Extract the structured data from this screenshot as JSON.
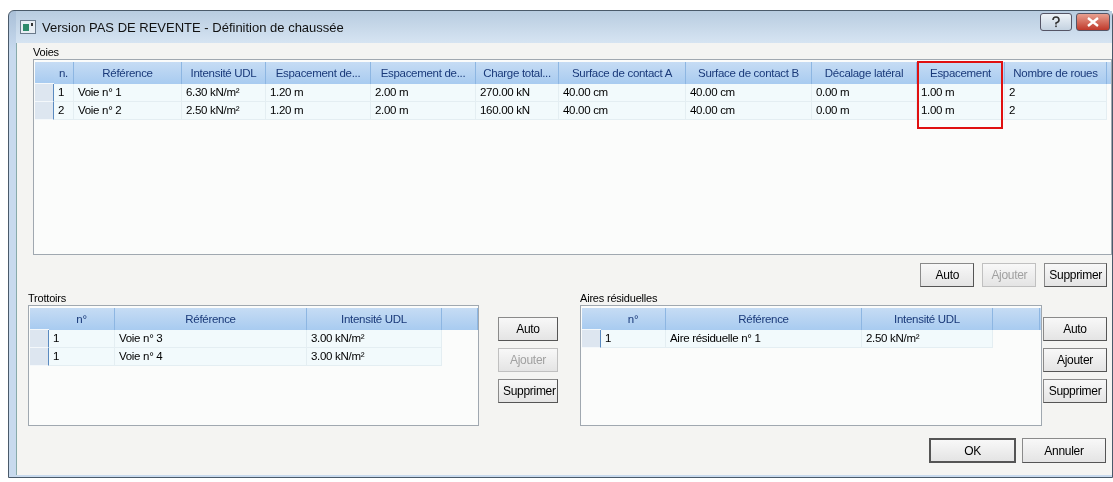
{
  "window": {
    "title": "Version PAS DE REVENTE - Définition de chaussée"
  },
  "voies": {
    "label": "Voies",
    "columns": [
      {
        "label": "n.",
        "highlighted": false
      },
      {
        "label": "Référence",
        "highlighted": false
      },
      {
        "label": "Intensité UDL",
        "highlighted": false
      },
      {
        "label": "Espacement de...",
        "highlighted": false
      },
      {
        "label": "Espacement de...",
        "highlighted": false
      },
      {
        "label": "Charge total...",
        "highlighted": false
      },
      {
        "label": "Surface de contact A",
        "highlighted": false
      },
      {
        "label": "Surface de contact B",
        "highlighted": false
      },
      {
        "label": "Décalage latéral",
        "highlighted": false
      },
      {
        "label": "Espacement",
        "highlighted": true
      },
      {
        "label": "Nombre de roues",
        "highlighted": false
      }
    ],
    "rows": [
      [
        "1",
        "Voie n° 1",
        "6.30 kN/m²",
        "1.20 m",
        "2.00 m",
        "270.00 kN",
        "40.00 cm",
        "40.00 cm",
        "0.00 m",
        "1.00 m",
        "2"
      ],
      [
        "2",
        "Voie n° 2",
        "2.50 kN/m²",
        "1.20 m",
        "2.00 m",
        "160.00 kN",
        "40.00 cm",
        "40.00 cm",
        "0.00 m",
        "1.00 m",
        "2"
      ]
    ],
    "buttons": [
      {
        "label": "Auto",
        "disabled": false
      },
      {
        "label": "Ajouter",
        "disabled": true
      },
      {
        "label": "Supprimer",
        "disabled": false
      }
    ]
  },
  "trottoirs": {
    "label": "Trottoirs",
    "columns": [
      "n°",
      "Référence",
      "Intensité UDL"
    ],
    "rows": [
      [
        "1",
        "Voie n° 3",
        "3.00 kN/m²"
      ],
      [
        "1",
        "Voie n° 4",
        "3.00 kN/m²"
      ]
    ],
    "buttons": [
      {
        "label": "Auto",
        "disabled": false
      },
      {
        "label": "Ajouter",
        "disabled": true
      },
      {
        "label": "Supprimer",
        "disabled": false
      }
    ]
  },
  "aires": {
    "label": "Aires résiduelles",
    "columns": [
      "n°",
      "Référence",
      "Intensité UDL"
    ],
    "rows": [
      [
        "1",
        "Aire résiduelle n° 1",
        "2.50 kN/m²"
      ]
    ],
    "buttons": [
      {
        "label": "Auto",
        "disabled": false
      },
      {
        "label": "Ajouter",
        "disabled": false
      },
      {
        "label": "Supprimer",
        "disabled": false
      }
    ]
  },
  "footer_buttons": [
    "OK",
    "Annuler"
  ]
}
